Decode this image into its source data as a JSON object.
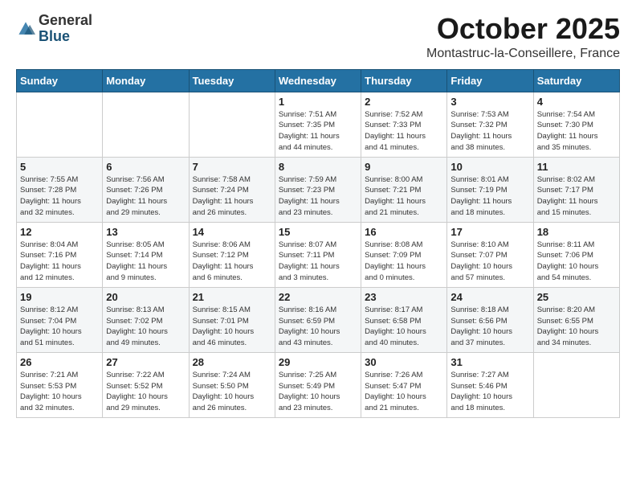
{
  "logo": {
    "general": "General",
    "blue": "Blue"
  },
  "header": {
    "title": "October 2025",
    "subtitle": "Montastruc-la-Conseillere, France"
  },
  "columns": [
    "Sunday",
    "Monday",
    "Tuesday",
    "Wednesday",
    "Thursday",
    "Friday",
    "Saturday"
  ],
  "weeks": [
    [
      {
        "day": "",
        "info": ""
      },
      {
        "day": "",
        "info": ""
      },
      {
        "day": "",
        "info": ""
      },
      {
        "day": "1",
        "info": "Sunrise: 7:51 AM\nSunset: 7:35 PM\nDaylight: 11 hours\nand 44 minutes."
      },
      {
        "day": "2",
        "info": "Sunrise: 7:52 AM\nSunset: 7:33 PM\nDaylight: 11 hours\nand 41 minutes."
      },
      {
        "day": "3",
        "info": "Sunrise: 7:53 AM\nSunset: 7:32 PM\nDaylight: 11 hours\nand 38 minutes."
      },
      {
        "day": "4",
        "info": "Sunrise: 7:54 AM\nSunset: 7:30 PM\nDaylight: 11 hours\nand 35 minutes."
      }
    ],
    [
      {
        "day": "5",
        "info": "Sunrise: 7:55 AM\nSunset: 7:28 PM\nDaylight: 11 hours\nand 32 minutes."
      },
      {
        "day": "6",
        "info": "Sunrise: 7:56 AM\nSunset: 7:26 PM\nDaylight: 11 hours\nand 29 minutes."
      },
      {
        "day": "7",
        "info": "Sunrise: 7:58 AM\nSunset: 7:24 PM\nDaylight: 11 hours\nand 26 minutes."
      },
      {
        "day": "8",
        "info": "Sunrise: 7:59 AM\nSunset: 7:23 PM\nDaylight: 11 hours\nand 23 minutes."
      },
      {
        "day": "9",
        "info": "Sunrise: 8:00 AM\nSunset: 7:21 PM\nDaylight: 11 hours\nand 21 minutes."
      },
      {
        "day": "10",
        "info": "Sunrise: 8:01 AM\nSunset: 7:19 PM\nDaylight: 11 hours\nand 18 minutes."
      },
      {
        "day": "11",
        "info": "Sunrise: 8:02 AM\nSunset: 7:17 PM\nDaylight: 11 hours\nand 15 minutes."
      }
    ],
    [
      {
        "day": "12",
        "info": "Sunrise: 8:04 AM\nSunset: 7:16 PM\nDaylight: 11 hours\nand 12 minutes."
      },
      {
        "day": "13",
        "info": "Sunrise: 8:05 AM\nSunset: 7:14 PM\nDaylight: 11 hours\nand 9 minutes."
      },
      {
        "day": "14",
        "info": "Sunrise: 8:06 AM\nSunset: 7:12 PM\nDaylight: 11 hours\nand 6 minutes."
      },
      {
        "day": "15",
        "info": "Sunrise: 8:07 AM\nSunset: 7:11 PM\nDaylight: 11 hours\nand 3 minutes."
      },
      {
        "day": "16",
        "info": "Sunrise: 8:08 AM\nSunset: 7:09 PM\nDaylight: 11 hours\nand 0 minutes."
      },
      {
        "day": "17",
        "info": "Sunrise: 8:10 AM\nSunset: 7:07 PM\nDaylight: 10 hours\nand 57 minutes."
      },
      {
        "day": "18",
        "info": "Sunrise: 8:11 AM\nSunset: 7:06 PM\nDaylight: 10 hours\nand 54 minutes."
      }
    ],
    [
      {
        "day": "19",
        "info": "Sunrise: 8:12 AM\nSunset: 7:04 PM\nDaylight: 10 hours\nand 51 minutes."
      },
      {
        "day": "20",
        "info": "Sunrise: 8:13 AM\nSunset: 7:02 PM\nDaylight: 10 hours\nand 49 minutes."
      },
      {
        "day": "21",
        "info": "Sunrise: 8:15 AM\nSunset: 7:01 PM\nDaylight: 10 hours\nand 46 minutes."
      },
      {
        "day": "22",
        "info": "Sunrise: 8:16 AM\nSunset: 6:59 PM\nDaylight: 10 hours\nand 43 minutes."
      },
      {
        "day": "23",
        "info": "Sunrise: 8:17 AM\nSunset: 6:58 PM\nDaylight: 10 hours\nand 40 minutes."
      },
      {
        "day": "24",
        "info": "Sunrise: 8:18 AM\nSunset: 6:56 PM\nDaylight: 10 hours\nand 37 minutes."
      },
      {
        "day": "25",
        "info": "Sunrise: 8:20 AM\nSunset: 6:55 PM\nDaylight: 10 hours\nand 34 minutes."
      }
    ],
    [
      {
        "day": "26",
        "info": "Sunrise: 7:21 AM\nSunset: 5:53 PM\nDaylight: 10 hours\nand 32 minutes."
      },
      {
        "day": "27",
        "info": "Sunrise: 7:22 AM\nSunset: 5:52 PM\nDaylight: 10 hours\nand 29 minutes."
      },
      {
        "day": "28",
        "info": "Sunrise: 7:24 AM\nSunset: 5:50 PM\nDaylight: 10 hours\nand 26 minutes."
      },
      {
        "day": "29",
        "info": "Sunrise: 7:25 AM\nSunset: 5:49 PM\nDaylight: 10 hours\nand 23 minutes."
      },
      {
        "day": "30",
        "info": "Sunrise: 7:26 AM\nSunset: 5:47 PM\nDaylight: 10 hours\nand 21 minutes."
      },
      {
        "day": "31",
        "info": "Sunrise: 7:27 AM\nSunset: 5:46 PM\nDaylight: 10 hours\nand 18 minutes."
      },
      {
        "day": "",
        "info": ""
      }
    ]
  ]
}
